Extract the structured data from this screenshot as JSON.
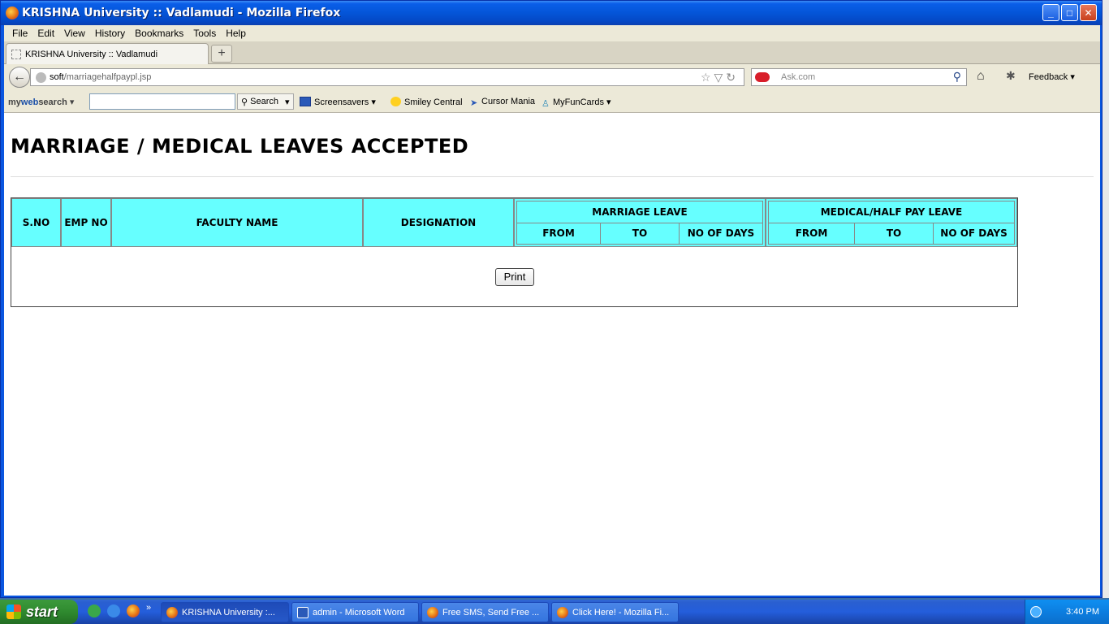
{
  "window": {
    "title": "KRISHNA University :: Vadlamudi - Mozilla Firefox",
    "controls": {
      "minimize": "_",
      "maximize": "□",
      "close": "✕"
    }
  },
  "menu": [
    "File",
    "Edit",
    "View",
    "History",
    "Bookmarks",
    "Tools",
    "Help"
  ],
  "tab": {
    "label": "KRISHNA University :: Vadlamudi",
    "new_tab": "+"
  },
  "nav": {
    "back": "←",
    "url_domain": "soft",
    "url_path": "/marriagehalfpaypl.jsp",
    "url_icons": "☆▽↻",
    "search_placeholder": "Ask.com",
    "feedback": "Feedback ▾"
  },
  "mws": {
    "logo_prefix": "my",
    "logo_bold": "web",
    "logo_suffix": "search ▾",
    "search_label": "Search",
    "dropdown": "▾",
    "items": [
      "Screensavers",
      "Smiley Central",
      "Cursor Mania",
      "MyFunCards"
    ]
  },
  "page": {
    "title": "MARRIAGE / MEDICAL LEAVES ACCEPTED",
    "columns": {
      "sno": "S.NO",
      "empno": "EMP NO",
      "faculty": "FACULTY NAME",
      "designation": "DESIGNATION"
    },
    "marriage": {
      "title": "MARRIAGE LEAVE",
      "from": "FROM",
      "to": "TO",
      "days": "NO OF DAYS"
    },
    "medical": {
      "title": "MEDICAL/HALF PAY LEAVE",
      "from": "FROM",
      "to": "TO",
      "days": "NO OF DAYS"
    },
    "print_button": "Print"
  },
  "taskbar": {
    "start": "start",
    "tasks": [
      "KRISHNA University :...",
      "admin - Microsoft Word",
      "Free SMS, Send Free ...",
      "Click Here! - Mozilla Fi..."
    ],
    "clock": "3:40 PM"
  },
  "colors": {
    "table_header": "#66ffff",
    "titlebar": "#0455d8",
    "taskbar": "#245edb"
  }
}
